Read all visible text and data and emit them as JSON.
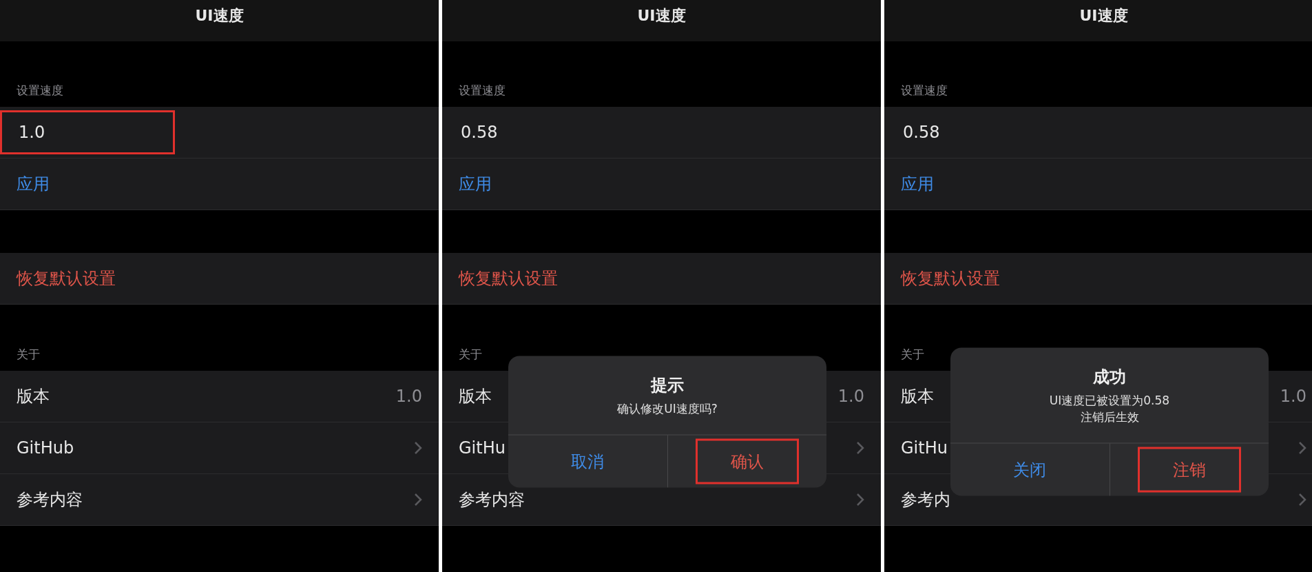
{
  "panels": [
    {
      "title": "UI速度",
      "speed_header": "设置速度",
      "speed_value": "1.0",
      "speed_highlighted": true,
      "apply": "应用",
      "reset": "恢复默认设置",
      "about_header": "关于",
      "rows": [
        {
          "kind": "value",
          "label": "版本",
          "value": "1.0"
        },
        {
          "kind": "link",
          "label": "GitHub"
        },
        {
          "kind": "link",
          "label": "参考内容"
        }
      ]
    },
    {
      "title": "UI速度",
      "speed_header": "设置速度",
      "speed_value": "0.58",
      "speed_highlighted": false,
      "apply": "应用",
      "reset": "恢复默认设置",
      "about_header": "关于",
      "rows": [
        {
          "kind": "value",
          "label": "版本",
          "value": "1.0"
        },
        {
          "kind": "link",
          "label": "GitHu"
        },
        {
          "kind": "link",
          "label": "参考内容"
        }
      ],
      "dialog": {
        "title": "提示",
        "message": [
          "确认修改UI速度吗?"
        ],
        "buttons": [
          {
            "label": "取消",
            "kind": "cancel",
            "highlighted": false
          },
          {
            "label": "确认",
            "kind": "destructive",
            "highlighted": true
          }
        ]
      }
    },
    {
      "title": "UI速度",
      "speed_header": "设置速度",
      "speed_value": "0.58",
      "speed_highlighted": false,
      "apply": "应用",
      "reset": "恢复默认设置",
      "about_header": "关于",
      "rows": [
        {
          "kind": "value",
          "label": "版本",
          "value": "1.0"
        },
        {
          "kind": "link",
          "label": "GitHu"
        },
        {
          "kind": "link",
          "label": "参考内"
        }
      ],
      "dialog": {
        "title": "成功",
        "message": [
          "UI速度已被设置为0.58",
          "注销后生效"
        ],
        "buttons": [
          {
            "label": "关闭",
            "kind": "cancel",
            "highlighted": false
          },
          {
            "label": "注销",
            "kind": "destructive",
            "highlighted": true
          }
        ]
      }
    }
  ]
}
